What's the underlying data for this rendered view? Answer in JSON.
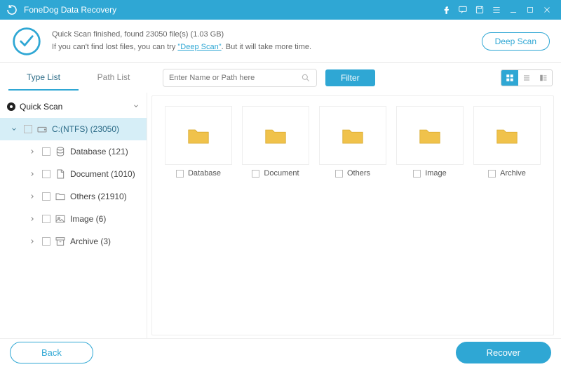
{
  "titlebar": {
    "app_name": "FoneDog Data Recovery"
  },
  "status": {
    "line1_prefix": "Quick Scan finished, found ",
    "file_count": "23050",
    "line1_mid": " file(s) (",
    "total_size": "1.03 GB",
    "line1_suffix": ")",
    "line2_prefix": "If you can't find lost files, you can try ",
    "deep_scan_link": "\"Deep Scan\"",
    "line2_suffix": ". But it will take more time.",
    "deep_scan_btn": "Deep Scan"
  },
  "toolbar": {
    "tab_type": "Type List",
    "tab_path": "Path List",
    "search_placeholder": "Enter Name or Path here",
    "filter_btn": "Filter"
  },
  "tree": {
    "root": "Quick Scan",
    "drive": "C:(NTFS) (23050)",
    "items": [
      {
        "label": "Database (121)"
      },
      {
        "label": "Document (1010)"
      },
      {
        "label": "Others (21910)"
      },
      {
        "label": "Image (6)"
      },
      {
        "label": "Archive (3)"
      }
    ]
  },
  "grid": {
    "folders": [
      {
        "label": "Database"
      },
      {
        "label": "Document"
      },
      {
        "label": "Others"
      },
      {
        "label": "Image"
      },
      {
        "label": "Archive"
      }
    ]
  },
  "bottom": {
    "back": "Back",
    "recover": "Recover"
  }
}
